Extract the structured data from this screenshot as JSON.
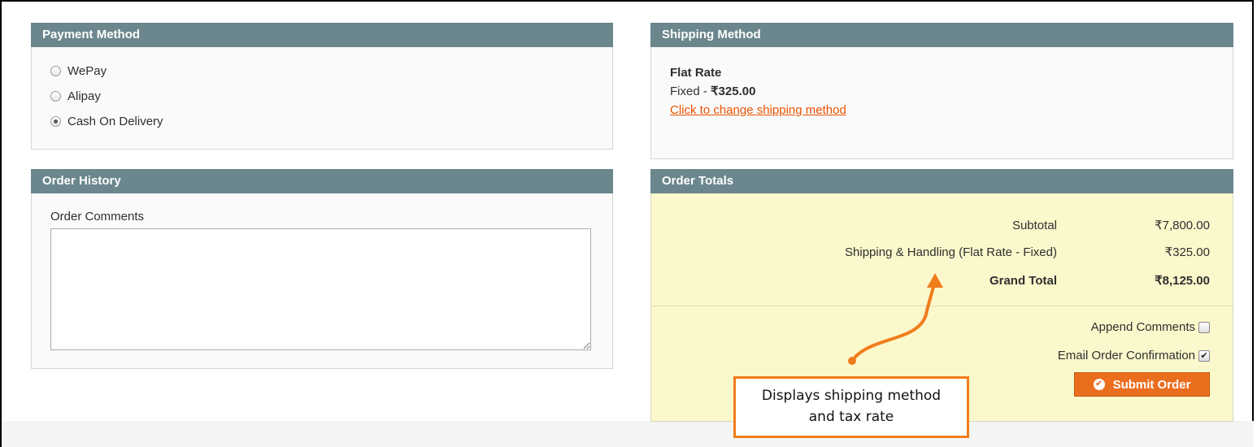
{
  "payment": {
    "title": "Payment Method",
    "options": [
      {
        "label": "WePay",
        "selected": false
      },
      {
        "label": "Alipay",
        "selected": false
      },
      {
        "label": "Cash On Delivery",
        "selected": true
      }
    ]
  },
  "shipping": {
    "title": "Shipping Method",
    "method_name": "Flat Rate",
    "method_detail_prefix": "Fixed - ",
    "method_price": "₹325.00",
    "change_link": "Click to change shipping method"
  },
  "history": {
    "title": "Order History",
    "comments_label": "Order Comments",
    "comments_value": ""
  },
  "totals": {
    "title": "Order Totals",
    "rows": [
      {
        "label": "Subtotal",
        "value": "₹7,800.00"
      },
      {
        "label": "Shipping & Handling (Flat Rate - Fixed)",
        "value": "₹325.00"
      },
      {
        "label": "Grand Total",
        "value": "₹8,125.00"
      }
    ],
    "append_comments_label": "Append Comments",
    "append_comments_checked": false,
    "email_confirmation_label": "Email Order Confirmation",
    "email_confirmation_checked": true,
    "submit_label": "Submit Order"
  },
  "annotation": {
    "text_line1": "Displays shipping method",
    "text_line2": "and tax rate",
    "color": "#f07d1c"
  },
  "colors": {
    "header_bg": "#6b878d",
    "totals_bg": "#fbf8cc",
    "accent": "#eb5202"
  }
}
